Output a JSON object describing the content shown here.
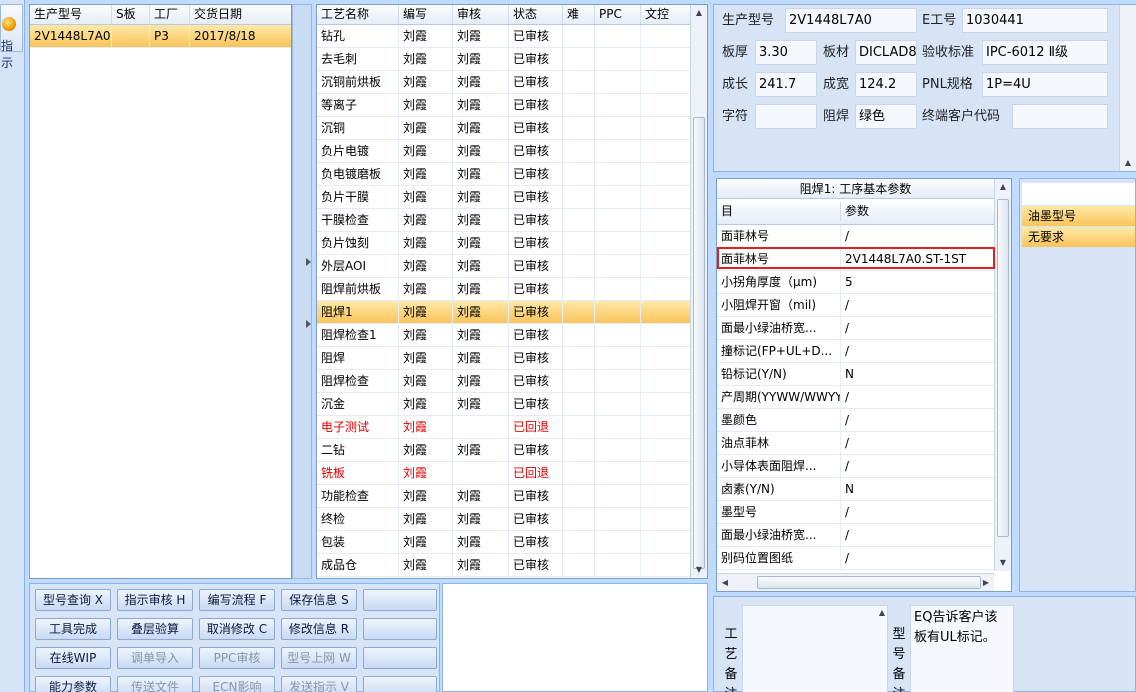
{
  "left_button": {
    "label": "指示"
  },
  "order_table": {
    "headers": [
      "生产型号",
      "S板",
      "工厂",
      "交货日期"
    ],
    "rows": [
      [
        "2V1448L7A0",
        "",
        "P3",
        "2017/8/18"
      ]
    ]
  },
  "process_table": {
    "headers": [
      "工艺名称",
      "编写",
      "审核",
      "状态",
      "难",
      "PPC",
      "文控"
    ],
    "rows": [
      {
        "name": "钻孔",
        "writer": "刘霞",
        "reviewer": "刘霞",
        "status": "已审核",
        "flag": ""
      },
      {
        "name": "去毛刺",
        "writer": "刘霞",
        "reviewer": "刘霞",
        "status": "已审核",
        "flag": ""
      },
      {
        "name": "沉铜前烘板",
        "writer": "刘霞",
        "reviewer": "刘霞",
        "status": "已审核",
        "flag": ""
      },
      {
        "name": "等离子",
        "writer": "刘霞",
        "reviewer": "刘霞",
        "status": "已审核",
        "flag": ""
      },
      {
        "name": "沉铜",
        "writer": "刘霞",
        "reviewer": "刘霞",
        "status": "已审核",
        "flag": ""
      },
      {
        "name": "负片电镀",
        "writer": "刘霞",
        "reviewer": "刘霞",
        "status": "已审核",
        "flag": ""
      },
      {
        "name": "负电镀磨板",
        "writer": "刘霞",
        "reviewer": "刘霞",
        "status": "已审核",
        "flag": ""
      },
      {
        "name": "负片干膜",
        "writer": "刘霞",
        "reviewer": "刘霞",
        "status": "已审核",
        "flag": ""
      },
      {
        "name": "干膜检查",
        "writer": "刘霞",
        "reviewer": "刘霞",
        "status": "已审核",
        "flag": ""
      },
      {
        "name": "负片蚀刻",
        "writer": "刘霞",
        "reviewer": "刘霞",
        "status": "已审核",
        "flag": ""
      },
      {
        "name": "外层AOI",
        "writer": "刘霞",
        "reviewer": "刘霞",
        "status": "已审核",
        "flag": ""
      },
      {
        "name": "阻焊前烘板",
        "writer": "刘霞",
        "reviewer": "刘霞",
        "status": "已审核",
        "flag": ""
      },
      {
        "name": "阻焊1",
        "writer": "刘霞",
        "reviewer": "刘霞",
        "status": "已审核",
        "flag": "selected"
      },
      {
        "name": "阻焊检查1",
        "writer": "刘霞",
        "reviewer": "刘霞",
        "status": "已审核",
        "flag": ""
      },
      {
        "name": "阻焊",
        "writer": "刘霞",
        "reviewer": "刘霞",
        "status": "已审核",
        "flag": ""
      },
      {
        "name": "阻焊检查",
        "writer": "刘霞",
        "reviewer": "刘霞",
        "status": "已审核",
        "flag": ""
      },
      {
        "name": "沉金",
        "writer": "刘霞",
        "reviewer": "刘霞",
        "status": "已审核",
        "flag": ""
      },
      {
        "name": "电子测试",
        "writer": "刘霞",
        "reviewer": "",
        "status": "已回退",
        "flag": "returned"
      },
      {
        "name": "二钻",
        "writer": "刘霞",
        "reviewer": "刘霞",
        "status": "已审核",
        "flag": ""
      },
      {
        "name": "铣板",
        "writer": "刘霞",
        "reviewer": "",
        "status": "已回退",
        "flag": "returned"
      },
      {
        "name": "功能检查",
        "writer": "刘霞",
        "reviewer": "刘霞",
        "status": "已审核",
        "flag": ""
      },
      {
        "name": "终检",
        "writer": "刘霞",
        "reviewer": "刘霞",
        "status": "已审核",
        "flag": ""
      },
      {
        "name": "包装",
        "writer": "刘霞",
        "reviewer": "刘霞",
        "status": "已审核",
        "flag": ""
      },
      {
        "name": "成品仓",
        "writer": "刘霞",
        "reviewer": "刘霞",
        "status": "已审核",
        "flag": ""
      }
    ]
  },
  "product_info": {
    "model_label": "生产型号",
    "model_value": "2V1448L7A0",
    "eno_label": "E工号",
    "eno_value": "1030441",
    "thickness_label": "板厚",
    "thickness_value": "3.30",
    "material_label": "板材",
    "material_value": "DICLAD8",
    "standard_label": "验收标准",
    "standard_value": "IPC-6012 Ⅱ级",
    "length_label": "成长",
    "length_value": "241.7",
    "width_label": "成宽",
    "width_value": "124.2",
    "pnl_label": "PNL规格",
    "pnl_value": "1P=4U",
    "char_label": "字符",
    "char_value": "",
    "mask_label": "阻焊",
    "mask_value": "绿色",
    "customer_label": "终端客户代码",
    "customer_value": ""
  },
  "param_panel": {
    "title": "阻焊1: 工序基本参数",
    "headers": [
      "目",
      "参数"
    ],
    "rows": [
      [
        "面菲林号",
        "/"
      ],
      [
        "面菲林号",
        "2V1448L7A0.ST-1ST"
      ],
      [
        "小拐角厚度（μm)",
        "5"
      ],
      [
        "小阻焊开窗（mil)",
        "/"
      ],
      [
        "面最小绿油桥宽...",
        "/"
      ],
      [
        "撞标记(FP+UL+D...",
        "/"
      ],
      [
        "铅标记(Y/N)",
        "N"
      ],
      [
        "产周期(YYWW/WWYY)",
        "/"
      ],
      [
        "墨颜色",
        "/"
      ],
      [
        "油点菲林",
        "/"
      ],
      [
        "小导体表面阻焊...",
        "/"
      ],
      [
        "卤素(Y/N)",
        "N"
      ],
      [
        "墨型号",
        "/"
      ],
      [
        "面最小绿油桥宽...",
        "/"
      ],
      [
        "别码位置图纸",
        "/"
      ]
    ]
  },
  "ink_panel": {
    "header": "油墨型号",
    "value": "无要求"
  },
  "buttons": [
    {
      "label": "型号查询",
      "key": "X",
      "enabled": true
    },
    {
      "label": "指示审核",
      "key": "H",
      "enabled": true
    },
    {
      "label": "编写流程",
      "key": "F",
      "enabled": true
    },
    {
      "label": "保存信息",
      "key": "S",
      "enabled": true
    },
    {
      "label": "",
      "key": "",
      "enabled": true
    },
    {
      "label": "工具完成",
      "key": "",
      "enabled": true
    },
    {
      "label": "叠层验算",
      "key": "",
      "enabled": true
    },
    {
      "label": "取消修改",
      "key": "C",
      "enabled": true
    },
    {
      "label": "修改信息",
      "key": "R",
      "enabled": true
    },
    {
      "label": "",
      "key": "",
      "enabled": true
    },
    {
      "label": "在线WIP",
      "key": "",
      "enabled": true
    },
    {
      "label": "调单导入",
      "key": "",
      "enabled": false
    },
    {
      "label": "PPC审核",
      "key": "",
      "enabled": false
    },
    {
      "label": "型号上网",
      "key": "W",
      "enabled": false
    },
    {
      "label": "",
      "key": "",
      "enabled": true
    },
    {
      "label": "能力参数",
      "key": "",
      "enabled": true
    },
    {
      "label": "传送文件",
      "key": "",
      "enabled": false
    },
    {
      "label": "ECN影响",
      "key": "",
      "enabled": false
    },
    {
      "label": "发送指示",
      "key": "V",
      "enabled": false
    },
    {
      "label": "",
      "key": "",
      "enabled": true
    }
  ],
  "bottom_right": {
    "process_note_label": "工艺备注",
    "model_note_label": "型号备注",
    "model_note_text": "EQ告诉客户该板有UL标记。"
  }
}
